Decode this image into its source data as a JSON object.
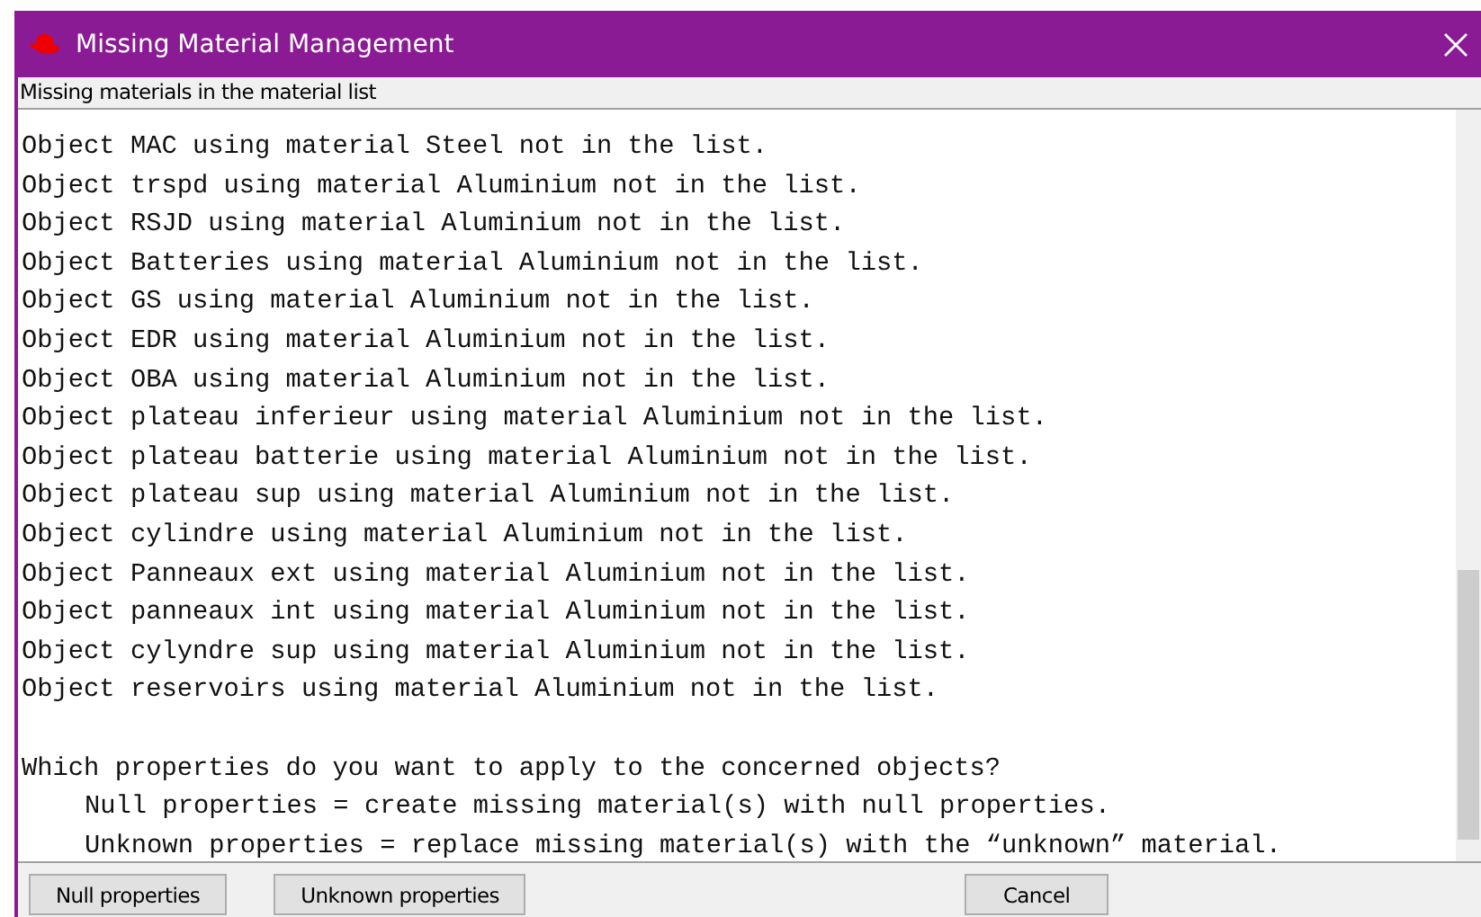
{
  "window": {
    "title": "Missing Material Management"
  },
  "header": {
    "label": "Missing materials in the material list"
  },
  "report": {
    "lines": [
      "Object MAC using material Steel not in the list.",
      "Object trspd using material Aluminium not in the list.",
      "Object RSJD using material Aluminium not in the list.",
      "Object Batteries using material Aluminium not in the list.",
      "Object GS using material Aluminium not in the list.",
      "Object EDR using material Aluminium not in the list.",
      "Object OBA using material Aluminium not in the list.",
      "Object plateau inferieur using material Aluminium not in the list.",
      "Object plateau batterie using material Aluminium not in the list.",
      "Object plateau sup using material Aluminium not in the list.",
      "Object cylindre using material Aluminium not in the list.",
      "Object Panneaux ext using material Aluminium not in the list.",
      "Object panneaux int using material Aluminium not in the list.",
      "Object cylyndre sup using material Aluminium not in the list.",
      "Object reservoirs using material Aluminium not in the list."
    ],
    "question": "Which properties do you want to apply to the concerned objects?",
    "options": [
      "Null properties = create missing material(s) with null properties.",
      "Unknown properties = replace missing material(s) with the “unknown” material."
    ]
  },
  "buttons": [
    {
      "label": "Null properties",
      "kind": "left"
    },
    {
      "label": "Unknown properties",
      "kind": "left"
    },
    {
      "label": "Cancel",
      "kind": "right"
    }
  ]
}
